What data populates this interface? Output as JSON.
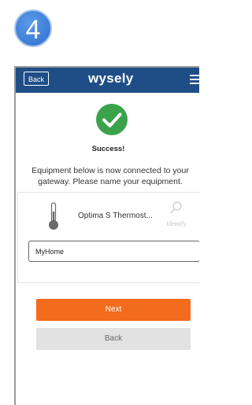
{
  "step": {
    "number": "4"
  },
  "navbar": {
    "back_label": "Back",
    "brand": "wysely",
    "menu_icon": "hamburger-menu-icon"
  },
  "status": {
    "icon": "check-circle-icon",
    "title": "Success!",
    "message": "Equipment below is now connected to your gateway. Please name your equipment."
  },
  "equipment": {
    "icon": "thermometer-icon",
    "name": "Optima S Thermost...",
    "identify_icon": "magnifier-icon",
    "identify_label": "Identify",
    "name_field": {
      "value": "MyHome"
    }
  },
  "actions": {
    "next_label": "Next",
    "back_label": "Back"
  },
  "colors": {
    "brand_blue": "#1f4e86",
    "success_green": "#3aa24a",
    "accent_orange": "#f36b1c",
    "secondary_gray": "#e2e2e2"
  }
}
